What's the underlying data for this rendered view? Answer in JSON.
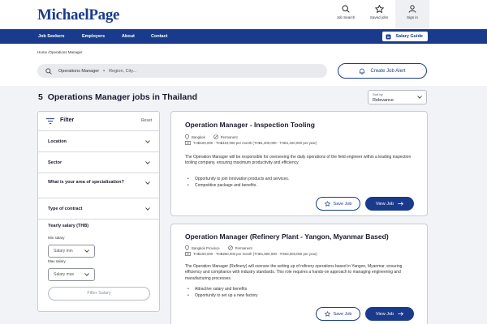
{
  "brand": {
    "logo": "MichaelPage",
    "primary_color": "#1a3b8c"
  },
  "header": {
    "job_search": "Job Search",
    "saved_jobs": "Saved jobs",
    "sign_in": "Sign in"
  },
  "nav": {
    "items": [
      "Job Seekers",
      "Employers",
      "About",
      "Contact"
    ],
    "salary_guide": "Salary Guide"
  },
  "breadcrumb": "Home /Operations Manager",
  "search": {
    "keyword": "Operations Manager",
    "location_placeholder": "Region, City..."
  },
  "create_alert": "Create Job Alert",
  "results": {
    "count": "5",
    "title": "Operations Manager jobs in Thailand"
  },
  "sort": {
    "label": "Sort by",
    "value": "Relevance"
  },
  "filter": {
    "title": "Filter",
    "reset": "Reset",
    "sections": [
      "Location",
      "Sector",
      "What is your area of specialisation?",
      "Type of contract"
    ],
    "yearly_salary": "Yearly salary (THB)",
    "min_label": "Min salary",
    "min_placeholder": "Salary min",
    "max_label": "Max salary",
    "max_placeholder": "Salary max",
    "filter_button": "Filter Salary"
  },
  "jobs": [
    {
      "title": "Operation Manager - Inspection Tooling",
      "location": "Bangkok",
      "contract": "Permanent",
      "salary": "THB100,000 - THB110,000 per month (THB1,200,000 - THB1,320,000 per year)",
      "description": "The Operation Manager will be responsible for overseeing the daily operations of the field engineer within a leading inspection tooling company, ensuring maximum productivity and efficiency.",
      "bullets": [
        "Opportunity to join innovation products and services.",
        "Competitive package and benefits."
      ],
      "save_label": "Save Job",
      "view_label": "View Job"
    },
    {
      "title": "Operation Manager (Refinery Plant - Yangon, Myanmar Based)",
      "location": "Bangkok Province",
      "contract": "Permanent",
      "salary": "THB150,000 - THB250,000 per month (THB1,800,000 - THB3,000,000 per year)",
      "description": "The Operation Manager (Refinery) will oversee the setting up of refinery operations based in Yangon, Myanmar, ensuring efficiency and compliance with industry standards. This role requires a hands-on approach to managing engineering and manufacturing processes.",
      "bullets": [
        "Attractive salary and benefits",
        "Opportunity to set up a new factory"
      ],
      "save_label": "Save Job",
      "view_label": "View Job"
    }
  ]
}
